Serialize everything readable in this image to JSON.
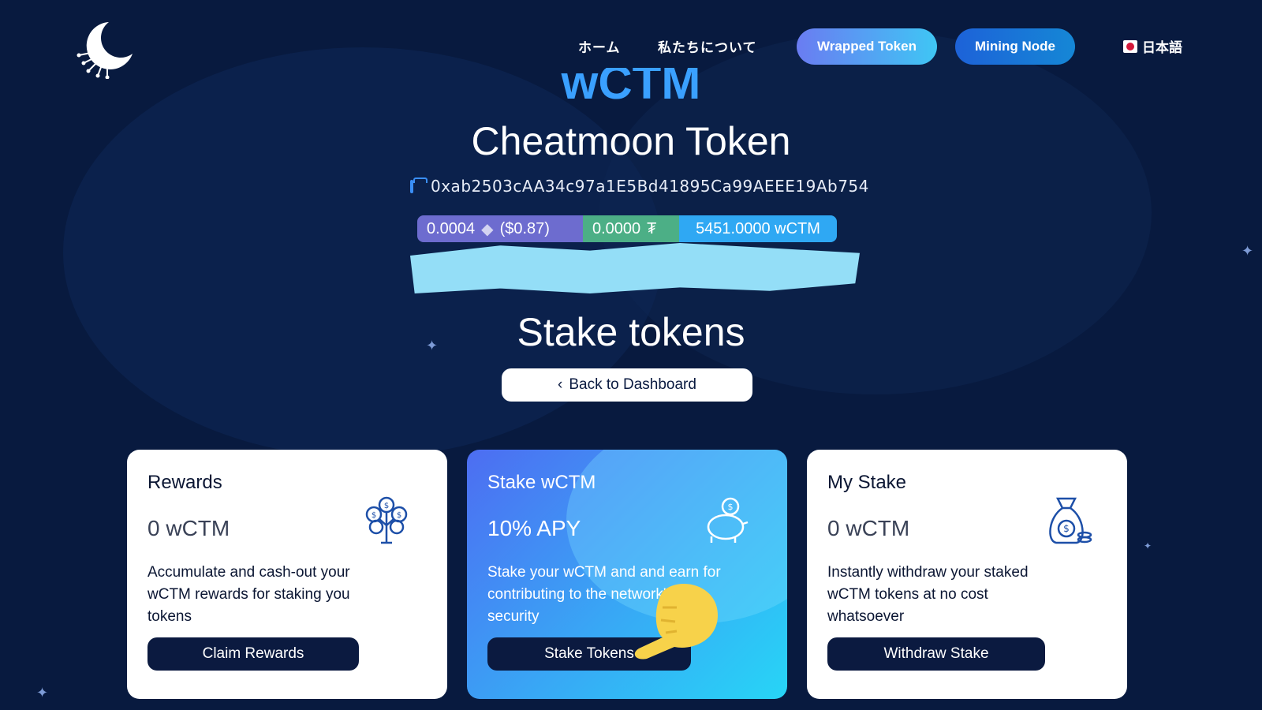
{
  "nav": {
    "home": "ホーム",
    "about": "私たちについて",
    "wrapped_token": "Wrapped Token",
    "mining_node": "Mining Node",
    "language": "日本語"
  },
  "token": {
    "symbol_partial": "wCTM",
    "name": "Cheatmoon Token",
    "address": "0xab2503cAA34c97a1E5Bd41895Ca99AEEE19Ab754"
  },
  "balances": {
    "eth_amount": "0.0004",
    "eth_usd": "($0.87)",
    "usdt_amount": "0.0000",
    "wctm_amount": "5451.0000 wCTM"
  },
  "page": {
    "title": "Stake tokens",
    "back_label": "Back to Dashboard"
  },
  "cards": {
    "rewards": {
      "title": "Rewards",
      "value": "0 wCTM",
      "description": "Accumulate and cash-out your wCTM rewards for staking you tokens",
      "button": "Claim Rewards",
      "icon": "money-tree-icon"
    },
    "stake": {
      "title": "Stake wCTM",
      "value": "10% APY",
      "description": "Stake your wCTM and and earn for contributing to the network's security",
      "button": "Stake Tokens",
      "icon": "piggy-bank-icon"
    },
    "my_stake": {
      "title": "My Stake",
      "value": "0 wCTM",
      "description": "Instantly withdraw your staked wCTM tokens at no cost whatsoever",
      "button": "Withdraw Stake",
      "icon": "money-bag-icon"
    }
  },
  "colors": {
    "background": "#081a3f",
    "accent_blue": "#3aa0ff",
    "button_dark": "#0b1a40",
    "eth_pill": "#6d6ccf",
    "usdt_pill": "#4caf86",
    "wctm_pill": "#2fa8f3"
  }
}
